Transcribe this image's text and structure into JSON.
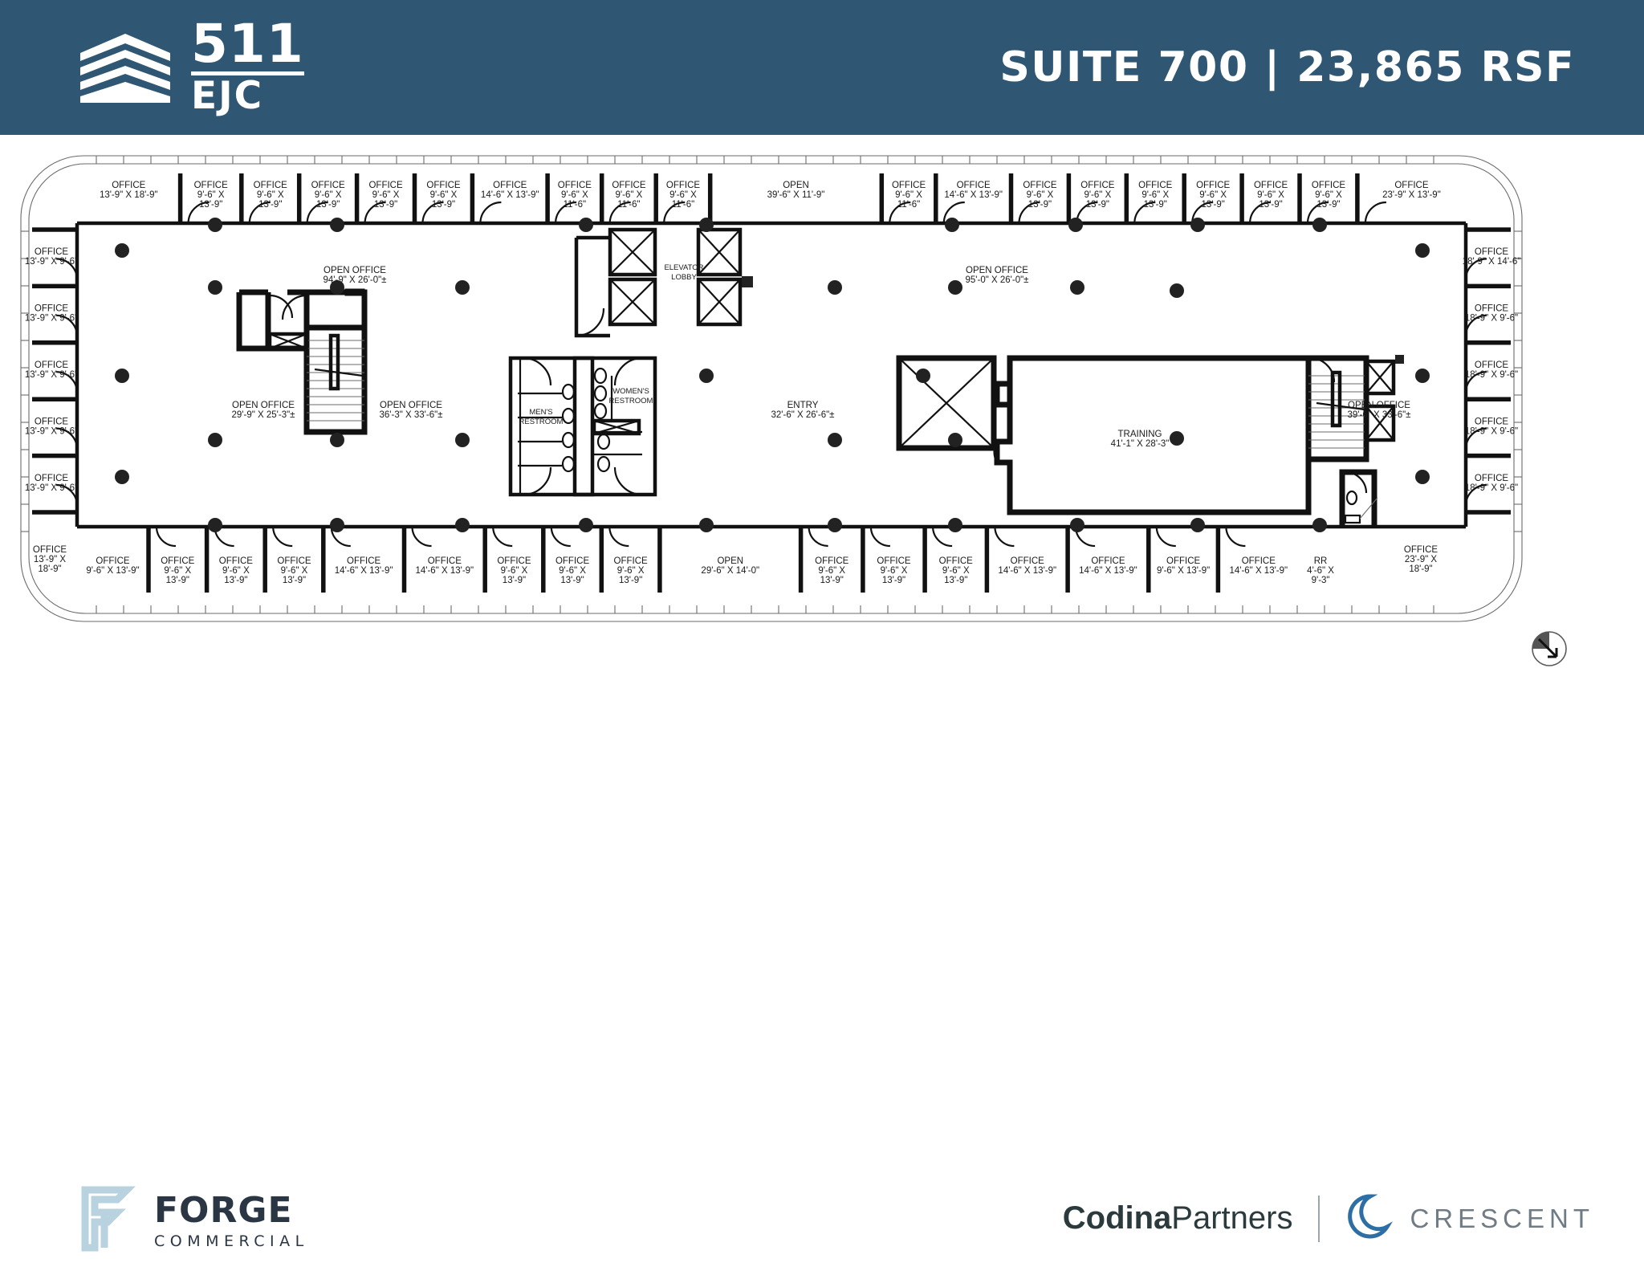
{
  "header": {
    "logo_number": "511",
    "logo_sub": "EJC",
    "logo_icon": "building-stack-icon",
    "title": "SUITE 700 | 23,865 RSF",
    "bg_color": "#2f5773"
  },
  "footer": {
    "forge_name": "FORGE",
    "forge_sub": "COMMERCIAL",
    "forge_icon": "forge-f-icon",
    "codina_bold": "Codina",
    "codina_light": "Partners",
    "crescent_name": "CRESCENT",
    "crescent_icon": "crescent-swirl-icon",
    "divider": "|"
  },
  "plan": {
    "north_arrow": "north-arrow-icon",
    "top_offices": [
      {
        "name": "OFFICE",
        "dim": "13'-9\" X 18'-9\""
      },
      {
        "name": "OFFICE",
        "dim": "9'-6\" X 13'-9\""
      },
      {
        "name": "OFFICE",
        "dim": "9'-6\" X 13'-9\""
      },
      {
        "name": "OFFICE",
        "dim": "9'-6\" X 13'-9\""
      },
      {
        "name": "OFFICE",
        "dim": "9'-6\" X 13'-9\""
      },
      {
        "name": "OFFICE",
        "dim": "9'-6\" X 13'-9\""
      },
      {
        "name": "OFFICE",
        "dim": "14'-6\" X 13'-9\""
      },
      {
        "name": "OFFICE",
        "dim": "9'-6\" X 11'-6\""
      },
      {
        "name": "OFFICE",
        "dim": "9'-6\" X 11'-6\""
      },
      {
        "name": "OFFICE",
        "dim": "9'-6\" X 11'-6\""
      },
      {
        "name": "OPEN",
        "dim": "39'-6\" X 11'-9\""
      },
      {
        "name": "OFFICE",
        "dim": "9'-6\" X 11'-6\""
      },
      {
        "name": "OFFICE",
        "dim": "14'-6\" X 13'-9\""
      },
      {
        "name": "OFFICE",
        "dim": "9'-6\" X 13'-9\""
      },
      {
        "name": "OFFICE",
        "dim": "9'-6\" X 13'-9\""
      },
      {
        "name": "OFFICE",
        "dim": "9'-6\" X 13'-9\""
      },
      {
        "name": "OFFICE",
        "dim": "9'-6\" X 13'-9\""
      },
      {
        "name": "OFFICE",
        "dim": "9'-6\" X 13'-9\""
      },
      {
        "name": "OFFICE",
        "dim": "9'-6\" X 13'-9\""
      },
      {
        "name": "OFFICE",
        "dim": "23'-9\" X 13'-9\""
      }
    ],
    "left_offices": [
      {
        "name": "OFFICE",
        "dim": "13'-9\" X 9'-6\""
      },
      {
        "name": "OFFICE",
        "dim": "13'-9\" X 9'-6\""
      },
      {
        "name": "OFFICE",
        "dim": "13'-9\" X 9'-6\""
      },
      {
        "name": "OFFICE",
        "dim": "13'-9\" X 9'-6\""
      },
      {
        "name": "OFFICE",
        "dim": "13'-9\" X 9'-6\""
      }
    ],
    "left_bottom_corner": {
      "name": "OFFICE",
      "dim": "13'-9\" X 18'-9\""
    },
    "right_offices": [
      {
        "name": "OFFICE",
        "dim": "18'-9\" X 14'-6\""
      },
      {
        "name": "OFFICE",
        "dim": "18'-9\" X 9'-6\""
      },
      {
        "name": "OFFICE",
        "dim": "18'-9\" X 9'-6\""
      },
      {
        "name": "OFFICE",
        "dim": "18'-9\" X 9'-6\""
      },
      {
        "name": "OFFICE",
        "dim": "18'-9\" X 9'-6\""
      }
    ],
    "right_bottom_corner": {
      "name": "OFFICE",
      "dim": "23'-9\" X 18'-9\""
    },
    "bottom_offices": [
      {
        "name": "OFFICE",
        "dim": "9'-6\" X 13'-9\""
      },
      {
        "name": "OFFICE",
        "dim": "9'-6\" X 13'-9\""
      },
      {
        "name": "OFFICE",
        "dim": "9'-6\" X 13'-9\""
      },
      {
        "name": "OFFICE",
        "dim": "9'-6\" X 13'-9\""
      },
      {
        "name": "OFFICE",
        "dim": "14'-6\" X 13'-9\""
      },
      {
        "name": "OFFICE",
        "dim": "14'-6\" X 13'-9\""
      },
      {
        "name": "OFFICE",
        "dim": "9'-6\" X 13'-9\""
      },
      {
        "name": "OFFICE",
        "dim": "9'-6\" X 13'-9\""
      },
      {
        "name": "OFFICE",
        "dim": "9'-6\" X 13'-9\""
      },
      {
        "name": "OPEN",
        "dim": "29'-6\" X 14'-0\""
      },
      {
        "name": "OFFICE",
        "dim": "9'-6\" X 13'-9\""
      },
      {
        "name": "OFFICE",
        "dim": "9'-6\" X 13'-9\""
      },
      {
        "name": "OFFICE",
        "dim": "9'-6\" X 13'-9\""
      },
      {
        "name": "OFFICE",
        "dim": "14'-6\" X 13'-9\""
      },
      {
        "name": "OFFICE",
        "dim": "14'-6\" X 13'-9\""
      },
      {
        "name": "OFFICE",
        "dim": "9'-6\" X 13'-9\""
      },
      {
        "name": "OFFICE",
        "dim": "14'-6\" X 13'-9\""
      },
      {
        "name": "RR",
        "dim": "4'-6\" X 9'-3\""
      }
    ],
    "core_rooms": [
      {
        "name": "OPEN OFFICE",
        "dim": "94'-9\" X 26'-0\"±"
      },
      {
        "name": "OPEN OFFICE",
        "dim": "95'-0\" X 26'-0\"±"
      },
      {
        "name": "OPEN OFFICE",
        "dim": "29'-9\" X 25'-3\"±"
      },
      {
        "name": "OPEN OFFICE",
        "dim": "36'-3\" X 33'-6\"±"
      },
      {
        "name": "OPEN OFFICE",
        "dim": "39'-6\" X 33'-6\"±"
      },
      {
        "name": "ENTRY",
        "dim": "32'-6\" X 26'-6\"±"
      },
      {
        "name": "TRAINING",
        "dim": "41'-1\" X 28'-3\""
      }
    ],
    "elevator_lobby": "ELEVATOR LOBBY",
    "mens_restroom": "MEN'S RESTROOM",
    "womens_restroom": "WOMEN'S RESTROOM"
  }
}
